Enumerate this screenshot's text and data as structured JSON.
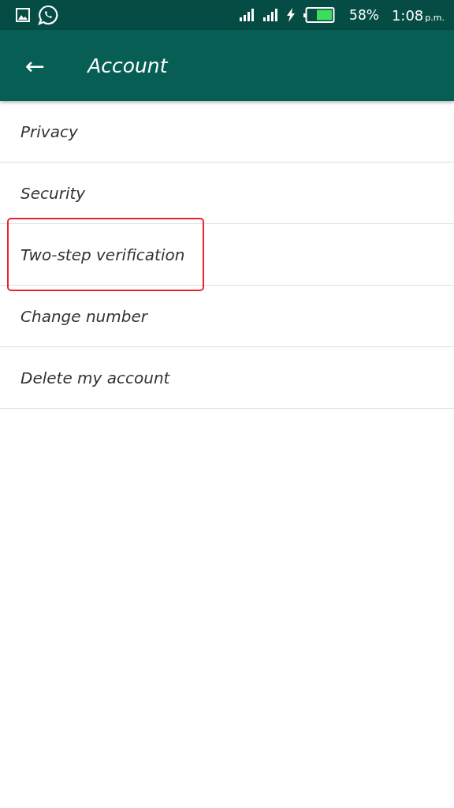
{
  "status_bar": {
    "battery": "58%",
    "time": "1:08",
    "time_suffix": "p.m."
  },
  "app_bar": {
    "back": "←",
    "title": "Account"
  },
  "items": [
    {
      "label": "Privacy",
      "highlighted": false
    },
    {
      "label": "Security",
      "highlighted": false
    },
    {
      "label": "Two-step verification",
      "highlighted": true
    },
    {
      "label": "Change number",
      "highlighted": false
    },
    {
      "label": "Delete my account",
      "highlighted": false
    }
  ]
}
